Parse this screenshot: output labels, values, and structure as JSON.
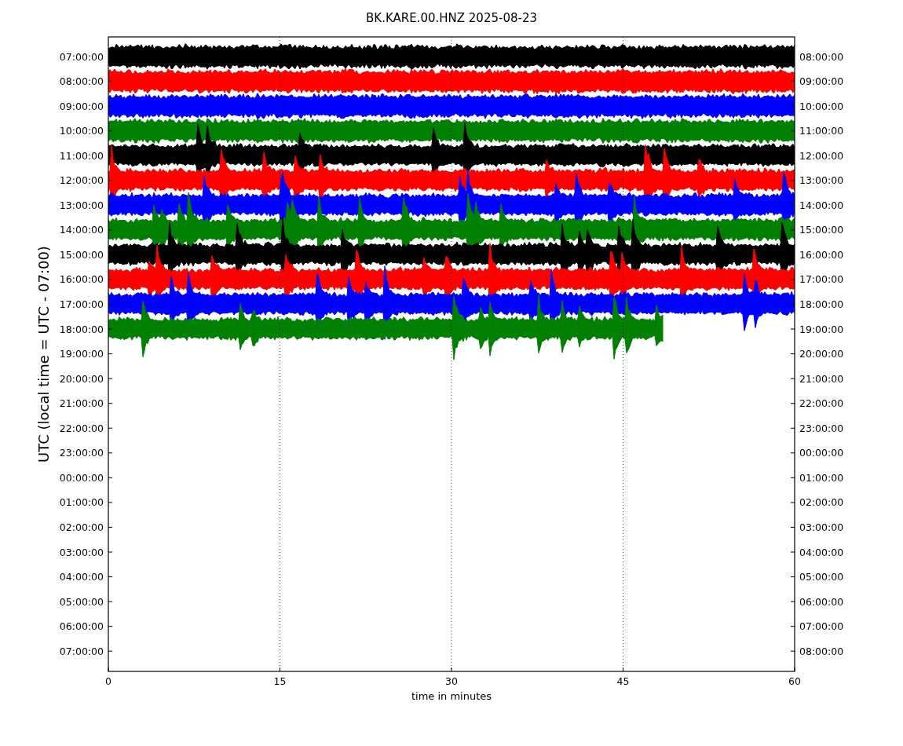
{
  "title": "BK.KARE.00.HNZ 2025-08-23",
  "y_axis_label": "UTC (local time = UTC - 07:00)",
  "x_axis_label": "time in minutes",
  "x_axis_ticks": [
    "0",
    "15",
    "30",
    "45",
    "60"
  ],
  "left_axis_labels": [
    "07:00:00",
    "08:00:00",
    "09:00:00",
    "10:00:00",
    "11:00:00",
    "12:00:00",
    "13:00:00",
    "14:00:00",
    "15:00:00",
    "16:00:00",
    "17:00:00",
    "18:00:00",
    "19:00:00",
    "20:00:00",
    "21:00:00",
    "22:00:00",
    "23:00:00",
    "00:00:00",
    "01:00:00",
    "02:00:00",
    "03:00:00",
    "04:00:00",
    "05:00:00",
    "06:00:00",
    "07:00:00"
  ],
  "right_axis_labels": [
    "08:00:00",
    "09:00:00",
    "10:00:00",
    "11:00:00",
    "12:00:00",
    "13:00:00",
    "14:00:00",
    "15:00:00",
    "16:00:00",
    "17:00:00",
    "18:00:00",
    "19:00:00",
    "20:00:00",
    "21:00:00",
    "22:00:00",
    "23:00:00",
    "00:00:00",
    "01:00:00",
    "02:00:00",
    "03:00:00",
    "04:00:00",
    "05:00:00",
    "06:00:00",
    "07:00:00",
    "08:00:00"
  ],
  "traces": [
    {
      "color": "#000000"
    },
    {
      "color": "#ff0000"
    },
    {
      "color": "#0000ff"
    },
    {
      "color": "#008000"
    },
    {
      "color": "#000000"
    },
    {
      "color": "#ff0000"
    },
    {
      "color": "#0000ff"
    },
    {
      "color": "#008000"
    },
    {
      "color": "#000000"
    },
    {
      "color": "#ff0000"
    },
    {
      "color": "#0000ff"
    },
    {
      "color": "#008000"
    }
  ]
}
